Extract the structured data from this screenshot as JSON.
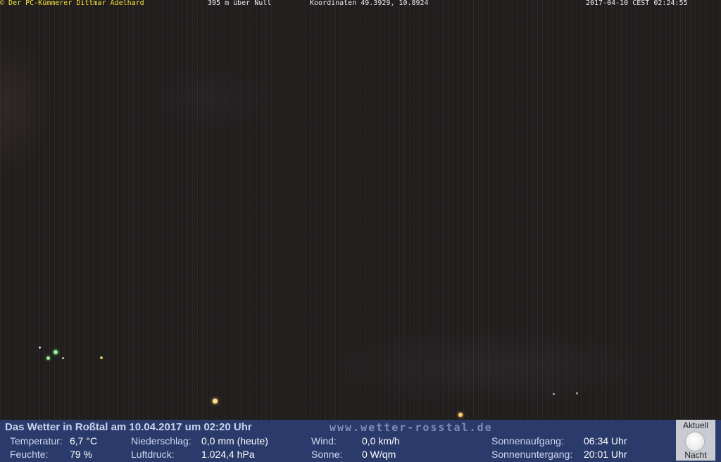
{
  "overlay": {
    "owner": "© Der PC-Kümmerer Dittmar Adelhard",
    "altitude": "395 m über Null",
    "coordinates": "Koordinaten 49.3929, 10.8924",
    "timestamp": "2017-04-10 CEST 02:24:55"
  },
  "footer": {
    "title": "Das Wetter in Roßtal am 10.04.2017 um 02:20 Uhr",
    "site": "www.wetter-rosstal.de",
    "temperature_label": "Temperatur:",
    "temperature_value": "6,7 °C",
    "humidity_label": "Feuchte:",
    "humidity_value": "79 %",
    "precip_label": "Niederschlag:",
    "precip_value": "0,0 mm (heute)",
    "pressure_label": "Luftdruck:",
    "pressure_value": "1.024,4 hPa",
    "wind_label": "Wind:",
    "wind_value": "0,0 km/h",
    "sun_label": "Sonne:",
    "sun_value": "0 W/qm",
    "sunrise_label": "Sonnenaufgang:",
    "sunrise_value": "06:34 Uhr",
    "sunset_label": "Sonnenuntergang:",
    "sunset_value": "20:01 Uhr",
    "moon_top_label": "Aktuell",
    "moon_bottom_label": "Nacht",
    "moon_icon": "moon-icon"
  }
}
